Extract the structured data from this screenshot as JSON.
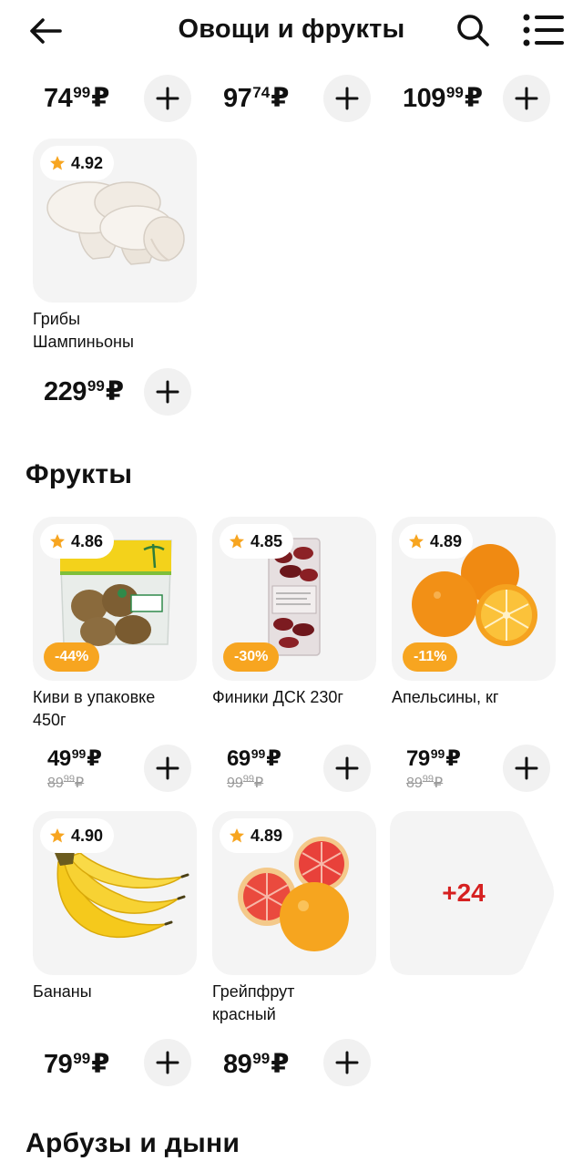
{
  "header": {
    "title": "Овощи и фрукты",
    "back_icon": "arrow-left-icon",
    "search_icon": "search-icon",
    "menu_icon": "list-menu-icon"
  },
  "top_row": [
    {
      "rub": "74",
      "kop": "99",
      "currency": "₽"
    },
    {
      "rub": "97",
      "kop": "74",
      "currency": "₽"
    },
    {
      "rub": "109",
      "kop": "99",
      "currency": "₽"
    }
  ],
  "mushroom": {
    "rating": "4.92",
    "name": "Грибы Шампиньоны",
    "price": {
      "rub": "229",
      "kop": "99",
      "currency": "₽"
    }
  },
  "sections": {
    "fruits": "Фрукты",
    "melons": "Арбузы и дыни"
  },
  "fruits": [
    {
      "rating": "4.86",
      "discount": "-44%",
      "name": "Киви в упаковке 450г",
      "price": {
        "rub": "49",
        "kop": "99",
        "currency": "₽"
      },
      "old_price": {
        "rub": "89",
        "kop": "99",
        "currency": "₽"
      }
    },
    {
      "rating": "4.85",
      "discount": "-30%",
      "name": "Финики ДСК 230г",
      "price": {
        "rub": "69",
        "kop": "99",
        "currency": "₽"
      },
      "old_price": {
        "rub": "99",
        "kop": "99",
        "currency": "₽"
      }
    },
    {
      "rating": "4.89",
      "discount": "-11%",
      "name": "Апельсины, кг",
      "price": {
        "rub": "79",
        "kop": "99",
        "currency": "₽"
      },
      "old_price": {
        "rub": "89",
        "kop": "99",
        "currency": "₽"
      }
    },
    {
      "rating": "4.90",
      "name": "Бананы",
      "price": {
        "rub": "79",
        "kop": "99",
        "currency": "₽"
      }
    },
    {
      "rating": "4.89",
      "name": "Грейпфрут красный",
      "price": {
        "rub": "89",
        "kop": "99",
        "currency": "₽"
      }
    }
  ],
  "more": {
    "label": "+24"
  },
  "colors": {
    "accent_orange": "#f7a520",
    "more_red": "#d62020",
    "card_bg": "#f4f4f4",
    "button_bg": "#f1f1f1"
  }
}
